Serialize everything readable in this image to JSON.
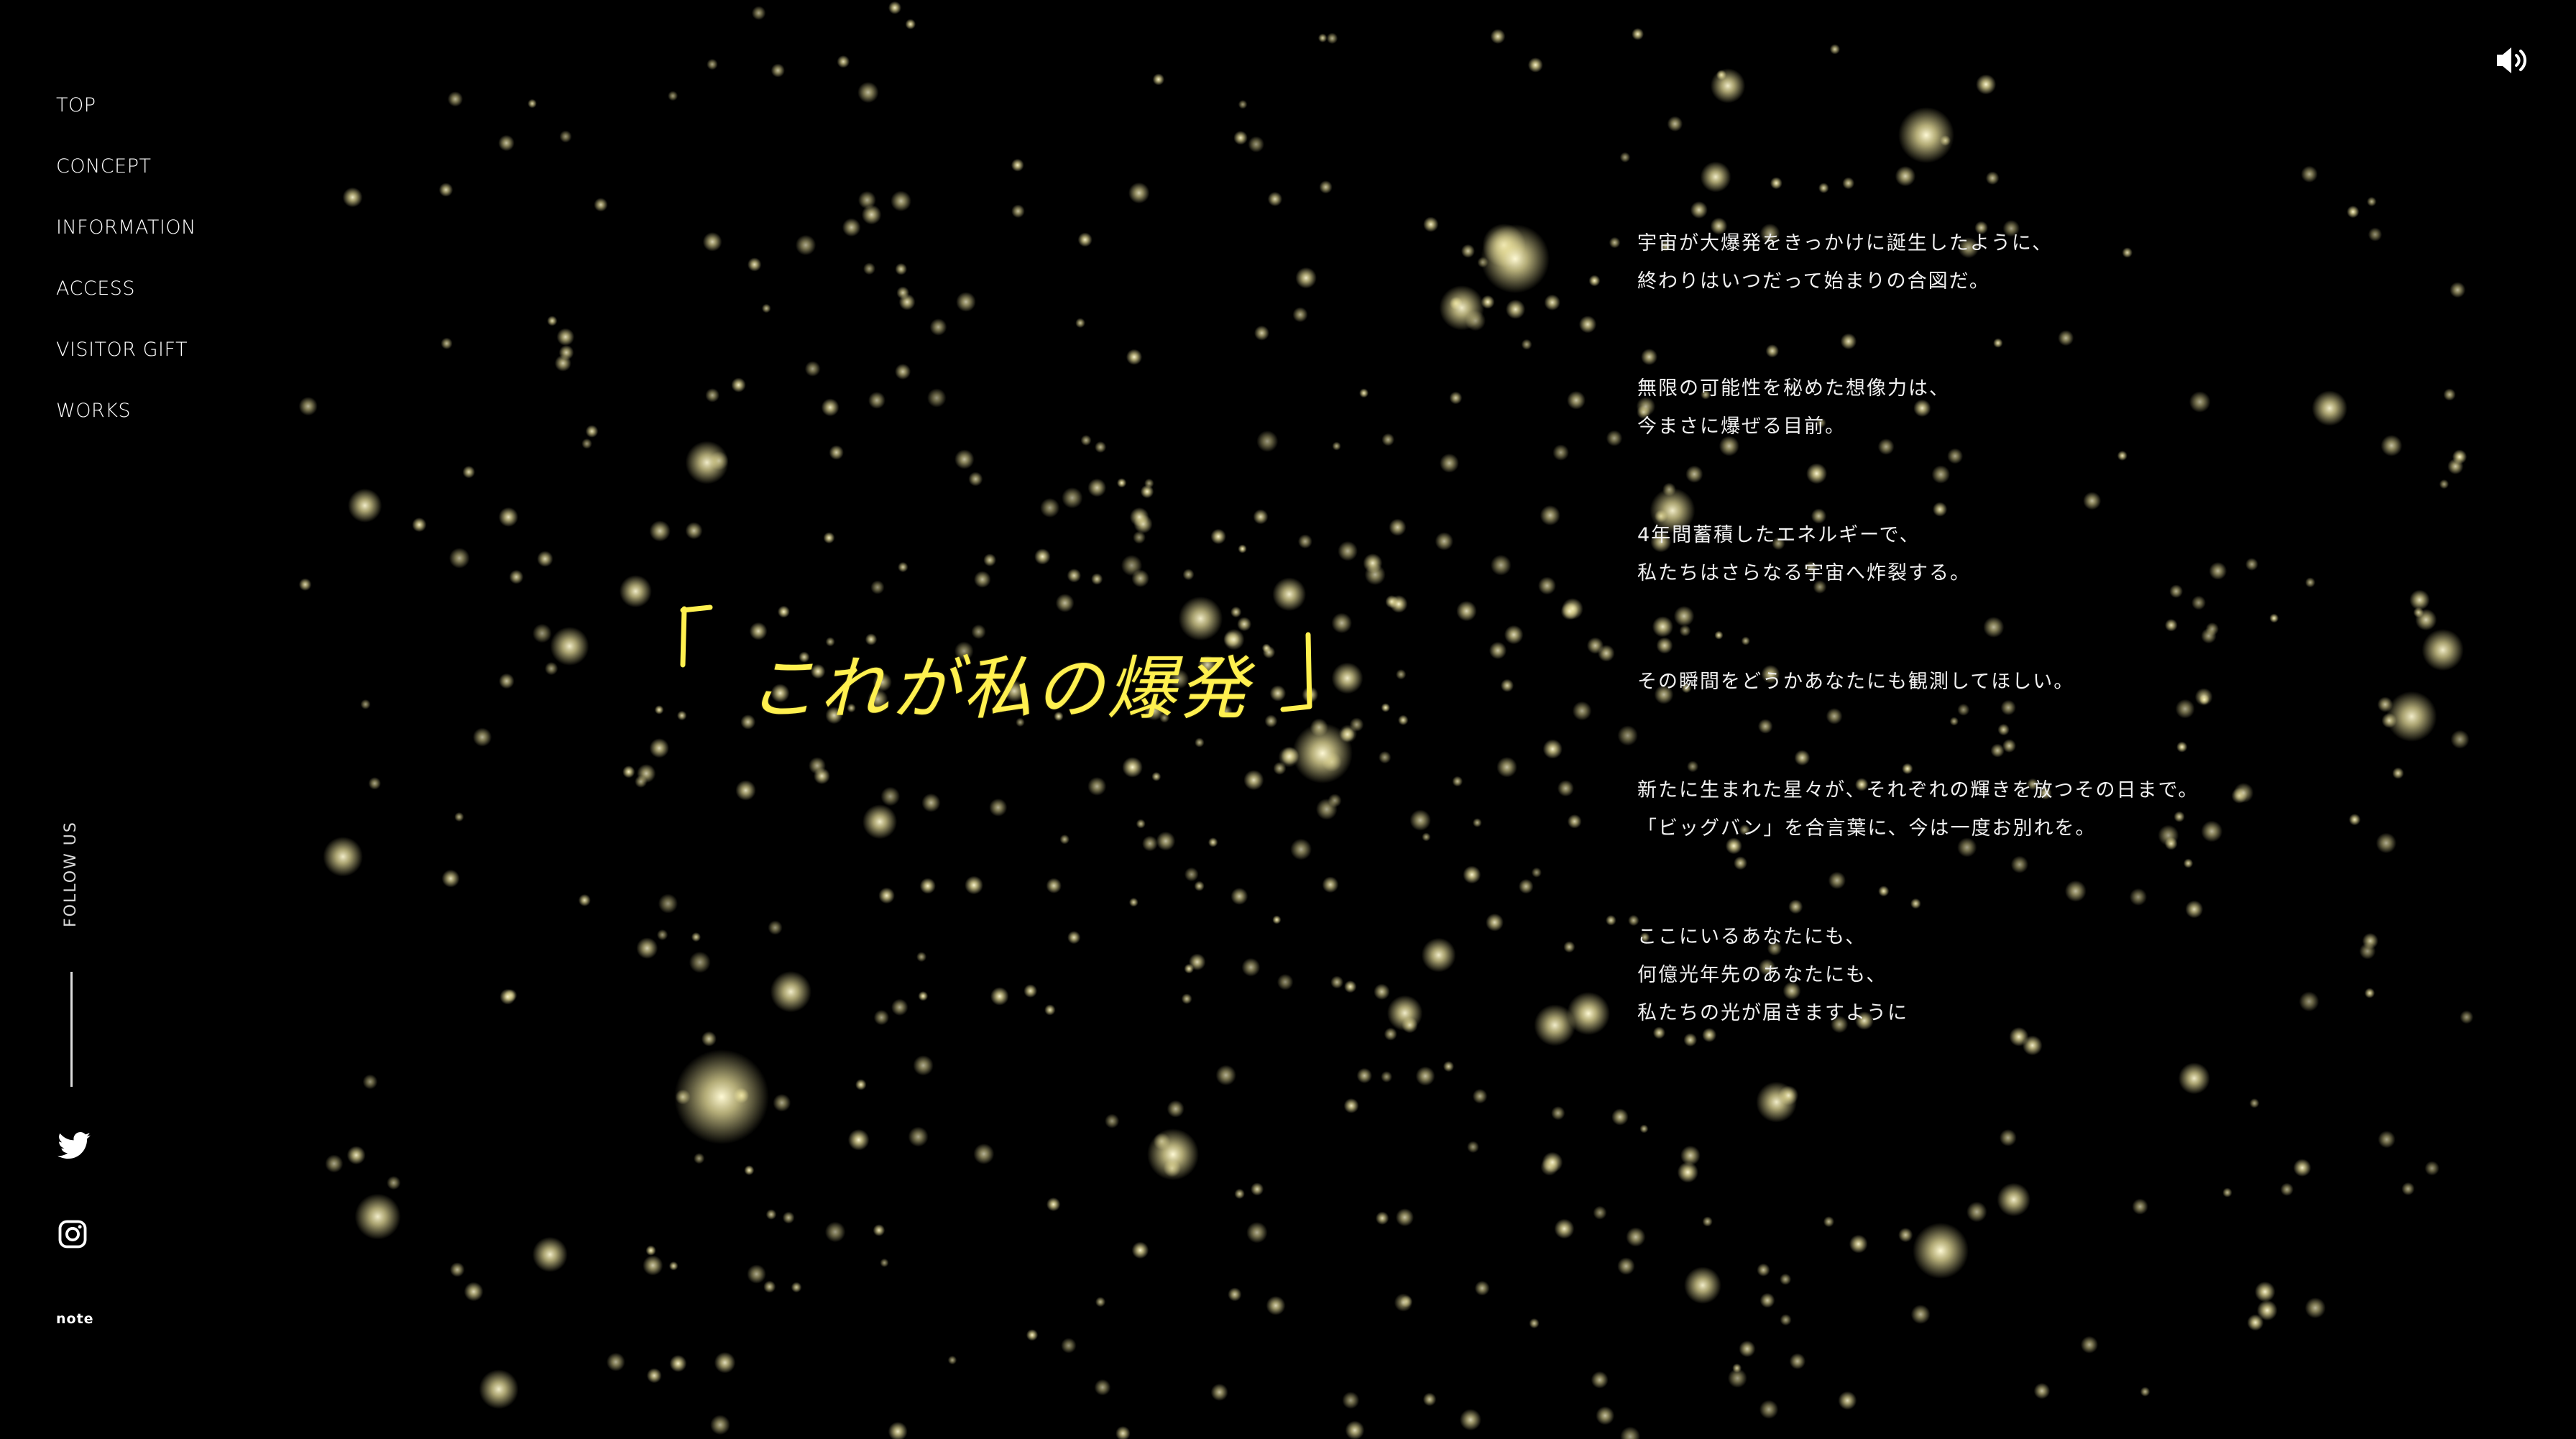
{
  "nav": {
    "items": [
      {
        "label": "TOP"
      },
      {
        "label": "CONCEPT"
      },
      {
        "label": "INFORMATION"
      },
      {
        "label": "ACCESS"
      },
      {
        "label": "VISITOR GIFT"
      },
      {
        "label": "WORKS"
      }
    ]
  },
  "social": {
    "follow_label": "FOLLOW US",
    "icons": [
      "twitter-icon",
      "instagram-icon"
    ],
    "note_label": "note"
  },
  "sound": {
    "icon": "speaker-icon"
  },
  "headline": {
    "open_bracket": "「",
    "text": "これが私の爆発",
    "close_bracket": "」",
    "color": "#fff04f"
  },
  "poem": {
    "stanzas": [
      {
        "lines": [
          "宇宙が大爆発をきっかけに誕生したように、",
          "終わりはいつだって始まりの合図だ。"
        ]
      },
      {
        "lines": [
          "無限の可能性を秘めた想像力は、",
          "今まさに爆ぜる目前。"
        ]
      },
      {
        "lines": [
          "4年間蓄積したエネルギーで、",
          "私たちはさらなる宇宙へ炸裂する。"
        ]
      },
      {
        "lines": [
          "その瞬間をどうかあなたにも観測してほしい。"
        ]
      },
      {
        "lines": [
          "新たに生まれた星々が、それぞれの輝きを放つその日まで。",
          "「ビッグバン」を合言葉に、今は一度お別れを。"
        ]
      },
      {
        "lines": [
          "ここにいるあなたにも、",
          "何億光年先のあなたにも、",
          "私たちの光が届きますように"
        ]
      }
    ]
  },
  "colors": {
    "background": "#000000",
    "star": "#f4efc0",
    "text": "#ffffff"
  }
}
